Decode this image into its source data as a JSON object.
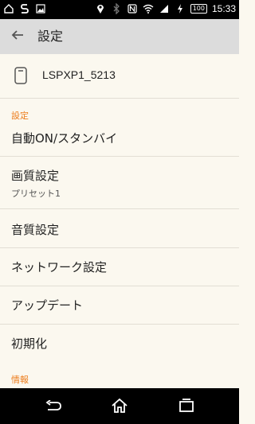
{
  "status_bar": {
    "time": "15:33",
    "battery": "100",
    "icons_left": [
      "home-icon",
      "s-logo-icon",
      "image-icon"
    ],
    "icons_right": [
      "location-icon",
      "bluetooth-icon",
      "nfc-icon",
      "wifi-icon",
      "signal-icon",
      "charging-icon",
      "battery-icon"
    ]
  },
  "app_bar": {
    "title": "設定",
    "back_icon": "arrow-back-icon"
  },
  "device": {
    "name": "LSPXP1_5213",
    "icon": "device-icon"
  },
  "sections": [
    {
      "header": "設定",
      "items": [
        {
          "label": "自動ON/スタンバイ",
          "sub": ""
        },
        {
          "label": "画質設定",
          "sub": "プリセット1"
        },
        {
          "label": "音質設定",
          "sub": ""
        },
        {
          "label": "ネットワーク設定",
          "sub": ""
        },
        {
          "label": "アップデート",
          "sub": ""
        },
        {
          "label": "初期化",
          "sub": ""
        }
      ]
    },
    {
      "header": "情報",
      "items": []
    }
  ],
  "colors": {
    "accent": "#ec7c1c",
    "background": "#fbf8ef",
    "app_bar": "#dcdcdc"
  },
  "nav_bar": {
    "buttons": [
      "back-nav-icon",
      "home-nav-icon",
      "recents-nav-icon"
    ]
  }
}
